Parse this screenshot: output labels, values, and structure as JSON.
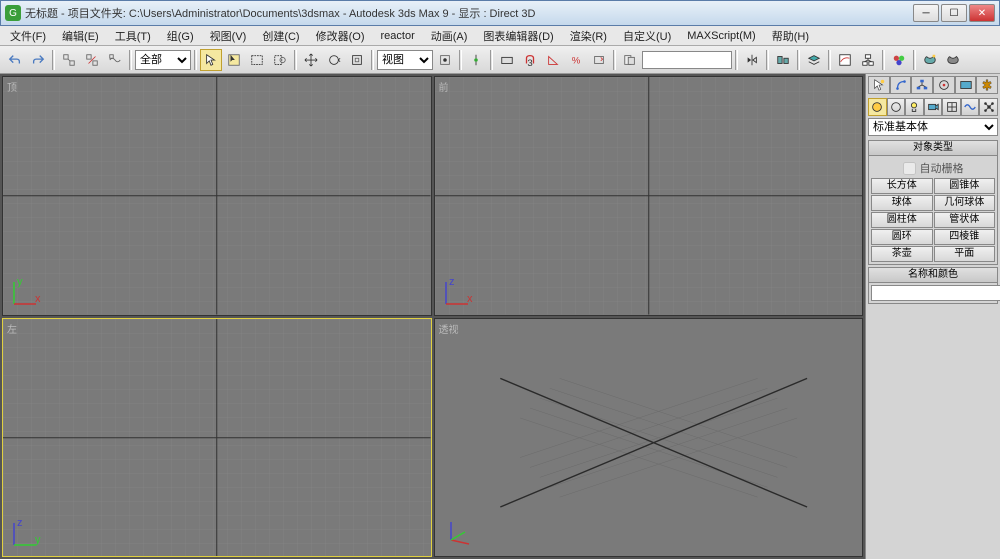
{
  "title": "无标题    - 项目文件夹: C:\\Users\\Administrator\\Documents\\3dsmax     - Autodesk 3ds Max 9     - 显示 : Direct 3D",
  "menu": [
    "文件(F)",
    "编辑(E)",
    "工具(T)",
    "组(G)",
    "视图(V)",
    "创建(C)",
    "修改器(O)",
    "reactor",
    "动画(A)",
    "图表编辑器(D)",
    "渲染(R)",
    "自定义(U)",
    "MAXScript(M)",
    "帮助(H)"
  ],
  "toolbar": {
    "selection_filter": "全部",
    "view_label": "视图"
  },
  "viewports": {
    "top": "顶",
    "front": "前",
    "left": "左",
    "perspective": "透视"
  },
  "panel": {
    "category": "标准基本体",
    "rollout_objtype": "对象类型",
    "autogrid": "自动栅格",
    "objects": [
      "长方体",
      "圆锥体",
      "球体",
      "几何球体",
      "圆柱体",
      "管状体",
      "圆环",
      "四棱锥",
      "茶壶",
      "平面"
    ],
    "rollout_name": "名称和颜色"
  }
}
